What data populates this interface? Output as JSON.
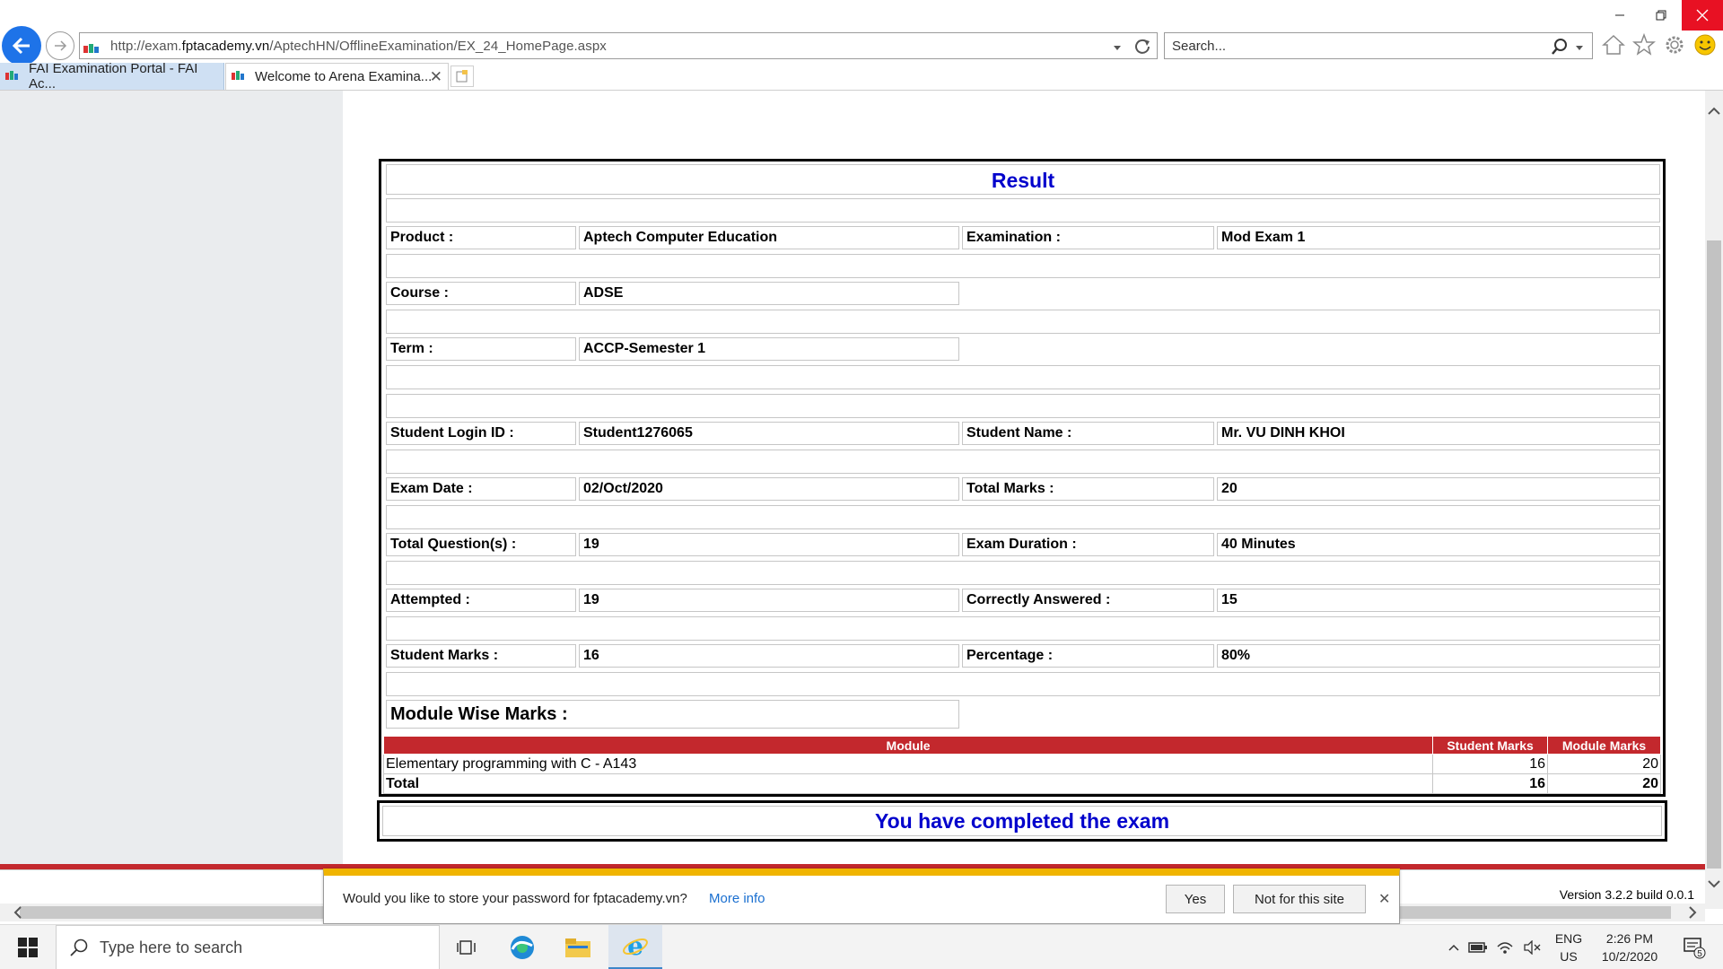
{
  "browser": {
    "url_prefix": "http://exam.",
    "url_domain": "fptacademy.vn",
    "url_path": "/AptechHN/OfflineExamination/EX_24_HomePage.aspx",
    "search_placeholder": "Search...",
    "tabs": [
      {
        "label": "FAI Examination Portal - FAI Ac..."
      },
      {
        "label": "Welcome to Arena Examina..."
      }
    ]
  },
  "result": {
    "title": "Result",
    "product_label": "Product :",
    "product_value": "Aptech Computer Education",
    "examination_label": "Examination :",
    "examination_value": "Mod Exam 1",
    "course_label": "Course :",
    "course_value": "ADSE",
    "term_label": "Term :",
    "term_value": "ACCP-Semester 1",
    "login_label": "Student Login ID :",
    "login_value": "Student1276065",
    "name_label": "Student Name :",
    "name_value": "Mr. VU DINH KHOI",
    "exam_date_label": "Exam Date :",
    "exam_date_value": "02/Oct/2020",
    "total_marks_label": "Total Marks :",
    "total_marks_value": "20",
    "questions_label": "Total Question(s) :",
    "questions_value": "19",
    "duration_label": "Exam Duration :",
    "duration_value": "40 Minutes",
    "attempted_label": "Attempted :",
    "attempted_value": "19",
    "correct_label": "Correctly Answered :",
    "correct_value": "15",
    "student_marks_label": "Student Marks :",
    "student_marks_value": "16",
    "percentage_label": "Percentage :",
    "percentage_value": "80%",
    "module_heading": "Module Wise Marks :"
  },
  "module_table": {
    "headers": [
      "Module",
      "Student Marks",
      "Module Marks"
    ],
    "rows": [
      {
        "module": "Elementary programming with C - A143",
        "student_marks": "16",
        "module_marks": "20"
      }
    ],
    "total": {
      "label": "Total",
      "student_marks": "16",
      "module_marks": "20"
    }
  },
  "completion_message": "You have completed the exam",
  "version": "Version 3.2.2 build 0.0.1",
  "password_prompt": {
    "message": "Would you like to store your password for fptacademy.vn?",
    "more_info": "More info",
    "yes": "Yes",
    "no": "Not for this site"
  },
  "taskbar": {
    "search_placeholder": "Type here to search",
    "lang_top": "ENG",
    "lang_bottom": "US",
    "time": "2:26 PM",
    "date": "10/2/2020",
    "notification_count": "5"
  },
  "colors": {
    "accent_blue": "#0000cc",
    "header_red": "#c3282d",
    "notify_yellow": "#f0b400",
    "back_button_blue": "#1e73e8"
  }
}
